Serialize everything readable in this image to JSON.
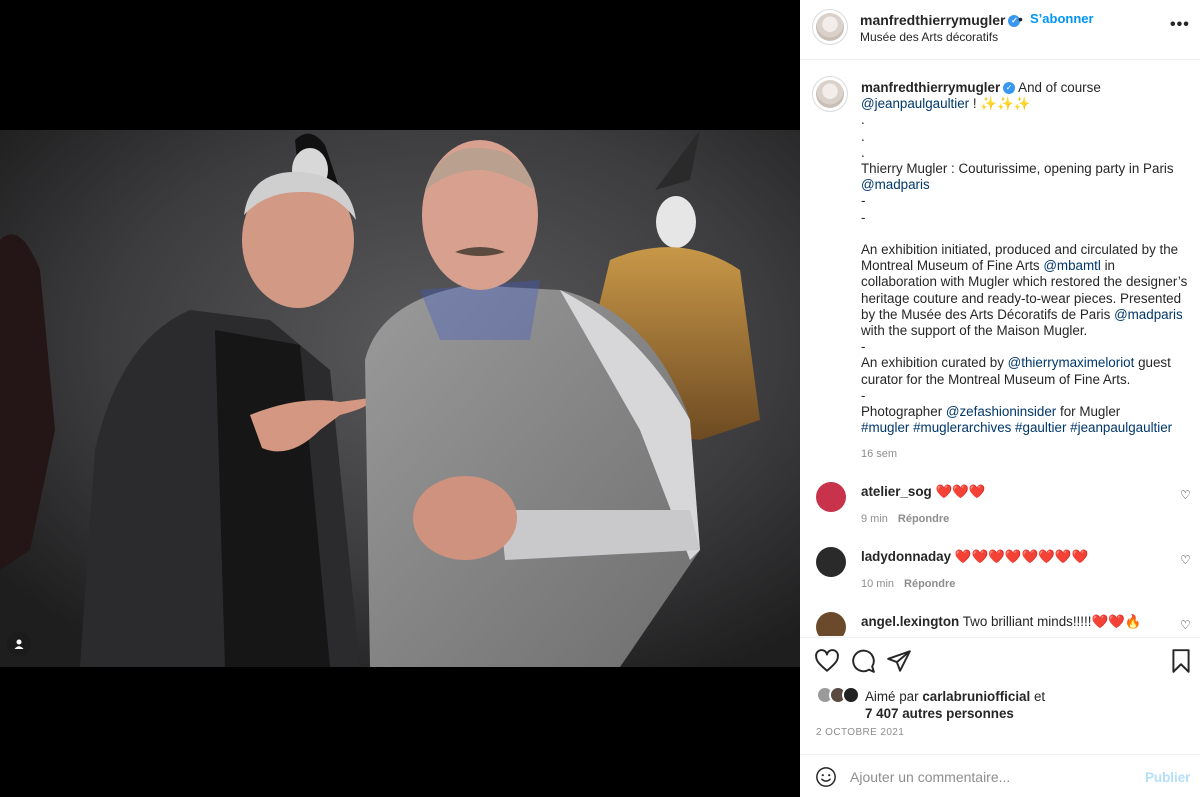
{
  "post": {
    "username": "manfredthierrymugler",
    "follow_label": "S’abonner",
    "separator": "•",
    "location": "Musée des Arts décoratifs",
    "more_glyph": "•••"
  },
  "caption": {
    "username": "manfredthierrymugler",
    "intro": "And of course",
    "mention_jpg": "@jeanpaulgaultier",
    "sparkles": " ! ✨✨✨",
    "dot1": ".",
    "dot2": ".",
    "dot3": ".",
    "line_party": "Thierry Mugler : Couturissime, opening party in Paris",
    "mention_madparis_1": "@madparis",
    "dash1": "-",
    "dash2": "-",
    "para1_a": "An exhibition initiated, produced and circulated by the Montreal Museum of Fine Arts ",
    "mention_mbamtl": "@mbamtl",
    "para1_b": " in collaboration with Mugler which restored the designer’s heritage couture and ready-to-wear pieces. Presented by the Musée des Arts Décoratifs de Paris ",
    "mention_madparis_2": "@madparis",
    "para1_c": " with the support of the Maison Mugler.",
    "dash3": "-",
    "para2_a": "An exhibition curated by ",
    "mention_curator": "@thierrymaximeloriot",
    "para2_b": " guest curator for the Montreal Museum of Fine Arts.",
    "dash4": "-",
    "para3_a": "Photographer ",
    "mention_photographer": "@zefashioninsider",
    "para3_b": " for Mugler",
    "hashtags": "#mugler #muglerarchives #gaultier #jeanpaulgaultier",
    "time": "16 sem"
  },
  "comments": [
    {
      "username": "atelier_sog",
      "text": "❤️❤️❤️",
      "time": "9 min",
      "reply": "Répondre",
      "avatar_color": "#c8324b"
    },
    {
      "username": "ladydonnaday",
      "text": "❤️❤️❤️❤️❤️❤️❤️❤️",
      "time": "10 min",
      "reply": "Répondre",
      "avatar_color": "#2a2a2a"
    },
    {
      "username": "angel.lexington",
      "text": "Two brilliant minds!!!!!❤️❤️🔥",
      "time": "",
      "reply": "",
      "avatar_color": "#6b4a2b"
    }
  ],
  "actions": {
    "like_icon": "heart-icon",
    "comment_icon": "comment-icon",
    "share_icon": "share-icon",
    "save_icon": "bookmark-icon"
  },
  "likes": {
    "prefix": "Aimé par ",
    "top_liker": "carlabruniofficial",
    "conjunction": " et",
    "others": "7 407 autres personnes"
  },
  "date": "2 OCTOBRE 2021",
  "composer": {
    "placeholder": "Ajouter un commentaire...",
    "publish_label": "Publier"
  },
  "colors": {
    "accent": "#0095f6",
    "verified": "#3897f0",
    "mention": "#00376b",
    "publish_disabled": "#b2dffc"
  }
}
